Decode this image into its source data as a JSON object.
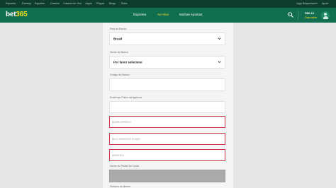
{
  "topbar": {
    "items": [
      "Esportes",
      "Fantasy",
      "Esportes",
      "Cassino",
      "Cassino Ao Vivo",
      "Jogos",
      "Pôquer",
      "Bingo",
      "Extra"
    ],
    "right": [
      "Jogo Responsável",
      "Ajuda"
    ]
  },
  "header": {
    "logo_main": "bet",
    "logo_accent": "365",
    "nav": [
      "Esportes",
      "Ao-Vivo",
      "Minhas Apostas"
    ],
    "balance": "R$0,15",
    "deposit": "Depositar"
  },
  "form": {
    "country_label": "País do Banco",
    "country_value": "Brasil",
    "bank_label": "Nome do Banco",
    "bank_value": "Por favor selecione",
    "branch_code_label": "Código do Banco",
    "branch_address_label": "Endereço Físico da Agência",
    "neighborhood_placeholder": "BAIRRO/PRÉDIO",
    "city_placeholder": "BELO HORIZONTE/ MGD",
    "zip_placeholder": "APAMORA",
    "holder_label": "Nome do Titular da Conta",
    "next_label": "Número do Banco"
  },
  "colors": {
    "brand_green": "#126e51",
    "top_dark": "#0f3d2d",
    "accent_yellow": "#ffdf1b",
    "error_red": "#d0343f"
  }
}
